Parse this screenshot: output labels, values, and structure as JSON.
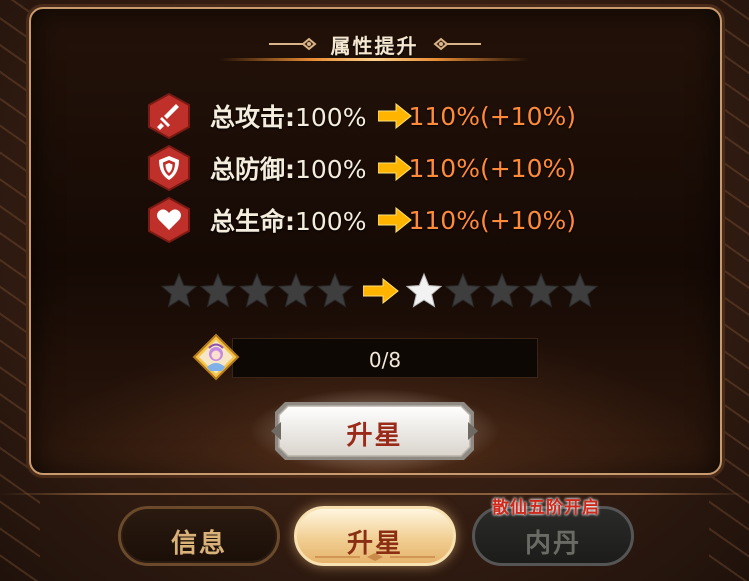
{
  "panel": {
    "title": "属性提升"
  },
  "stats": [
    {
      "label": "总攻击:",
      "current": "100%",
      "next": "110%(+10%)",
      "icon": "sword-icon"
    },
    {
      "label": "总防御:",
      "current": "100%",
      "next": "110%(+10%)",
      "icon": "shield-icon"
    },
    {
      "label": "总生命:",
      "current": "100%",
      "next": "110%(+10%)",
      "icon": "heart-icon"
    }
  ],
  "stars": {
    "current_filled": 0,
    "current_total": 5,
    "next_filled": 1,
    "next_total": 5
  },
  "progress": {
    "text": "0/8",
    "value": 0,
    "max": 8,
    "icon": "character-shard-icon"
  },
  "upgrade_button": {
    "label": "升星"
  },
  "tabs": [
    {
      "label": "信息",
      "state": "normal"
    },
    {
      "label": "升星",
      "state": "selected"
    },
    {
      "label": "内丹",
      "state": "locked",
      "note": "散仙五阶开启"
    }
  ],
  "colors": {
    "accent_orange": "#ff8a3a",
    "icon_red": "#c0302a",
    "star_empty": "#3e3e3e",
    "star_filled": "#f2f2f2",
    "locked_note": "#d0291c"
  }
}
